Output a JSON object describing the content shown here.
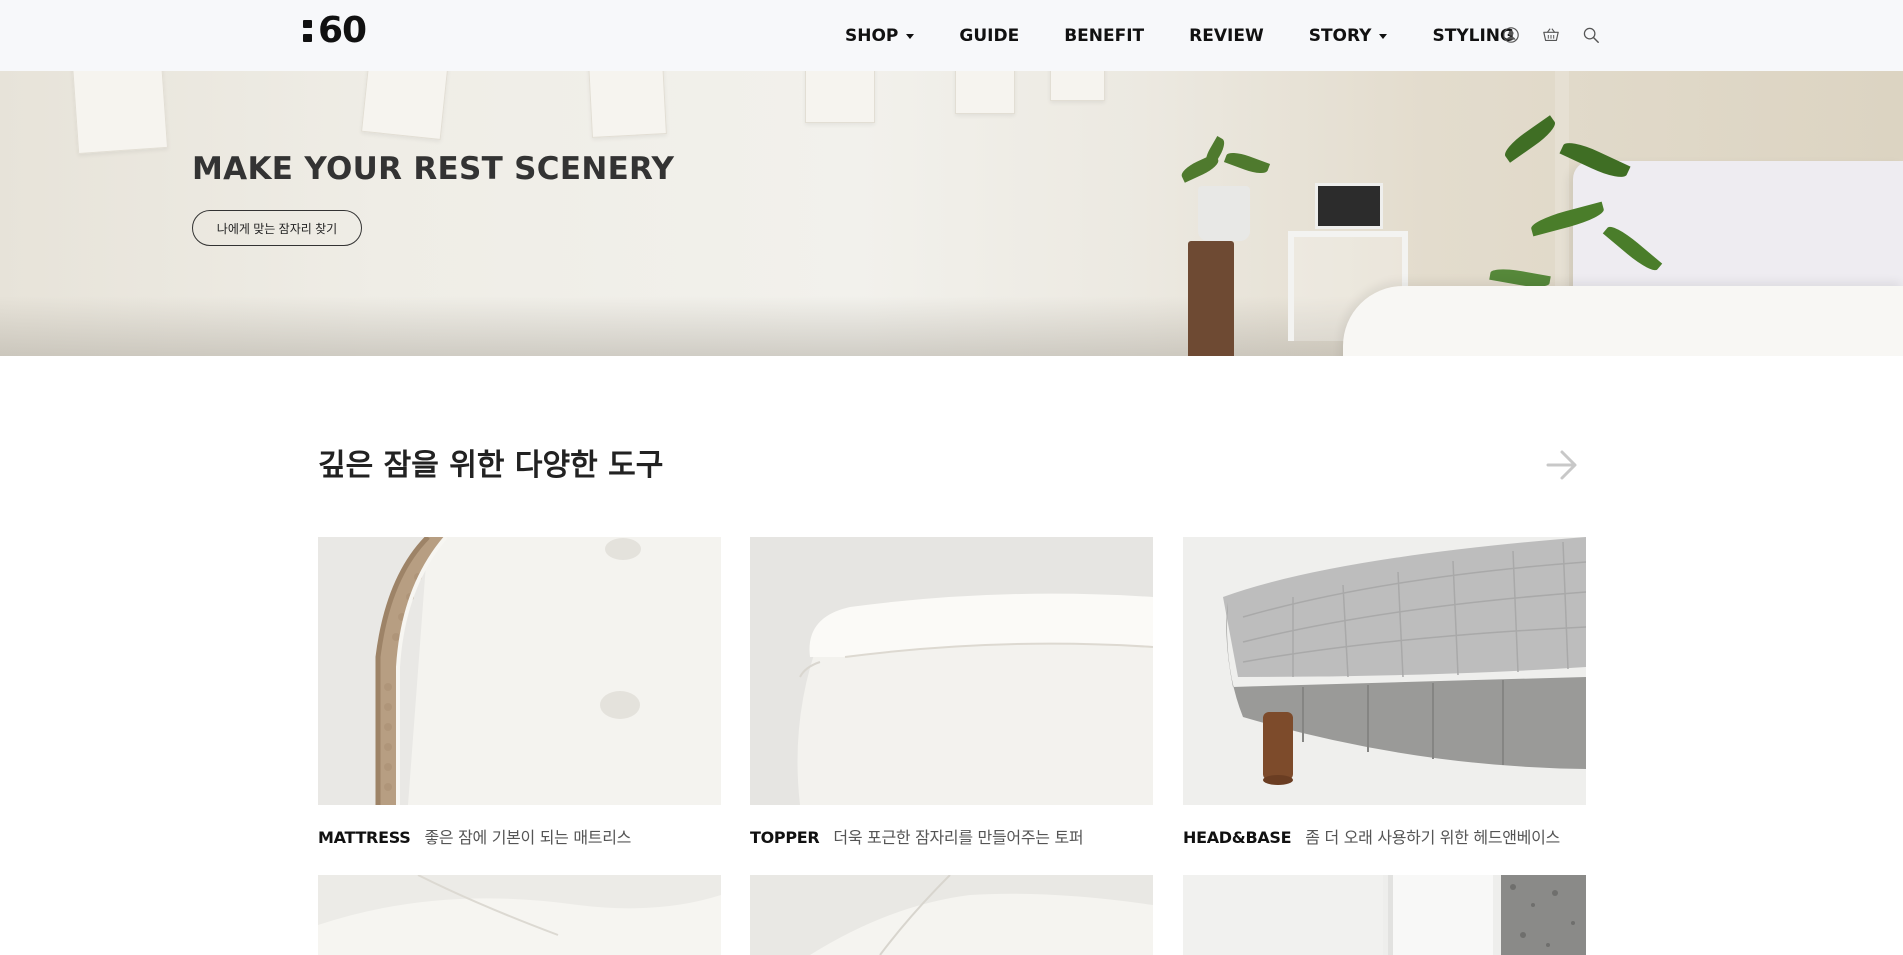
{
  "header": {
    "logo_text": "60",
    "nav": [
      {
        "label": "SHOP",
        "dropdown": true
      },
      {
        "label": "GUIDE",
        "dropdown": false
      },
      {
        "label": "BENEFIT",
        "dropdown": false
      },
      {
        "label": "REVIEW",
        "dropdown": false
      },
      {
        "label": "STORY",
        "dropdown": true
      },
      {
        "label": "STYLING",
        "dropdown": false
      }
    ],
    "icons": [
      "user-icon",
      "basket-icon",
      "search-icon"
    ]
  },
  "hero": {
    "title": "MAKE YOUR REST SCENERY",
    "button_label": "나에게 맞는 잠자리 찾기"
  },
  "section": {
    "title": "깊은 잠을 위한 다양한 도구",
    "next_icon": "arrow-right-icon"
  },
  "products": [
    {
      "category": "MATTRESS",
      "description": "좋은 잠에 기본이 되는 매트리스"
    },
    {
      "category": "TOPPER",
      "description": "더욱 포근한 잠자리를 만들어주는 토퍼"
    },
    {
      "category": "HEAD&BASE",
      "description": "좀 더 오래 사용하기 위한 헤드앤베이스"
    }
  ],
  "colors": {
    "header_bg": "#f7f8fa",
    "text_dark": "#111111",
    "text_muted": "#555555"
  }
}
